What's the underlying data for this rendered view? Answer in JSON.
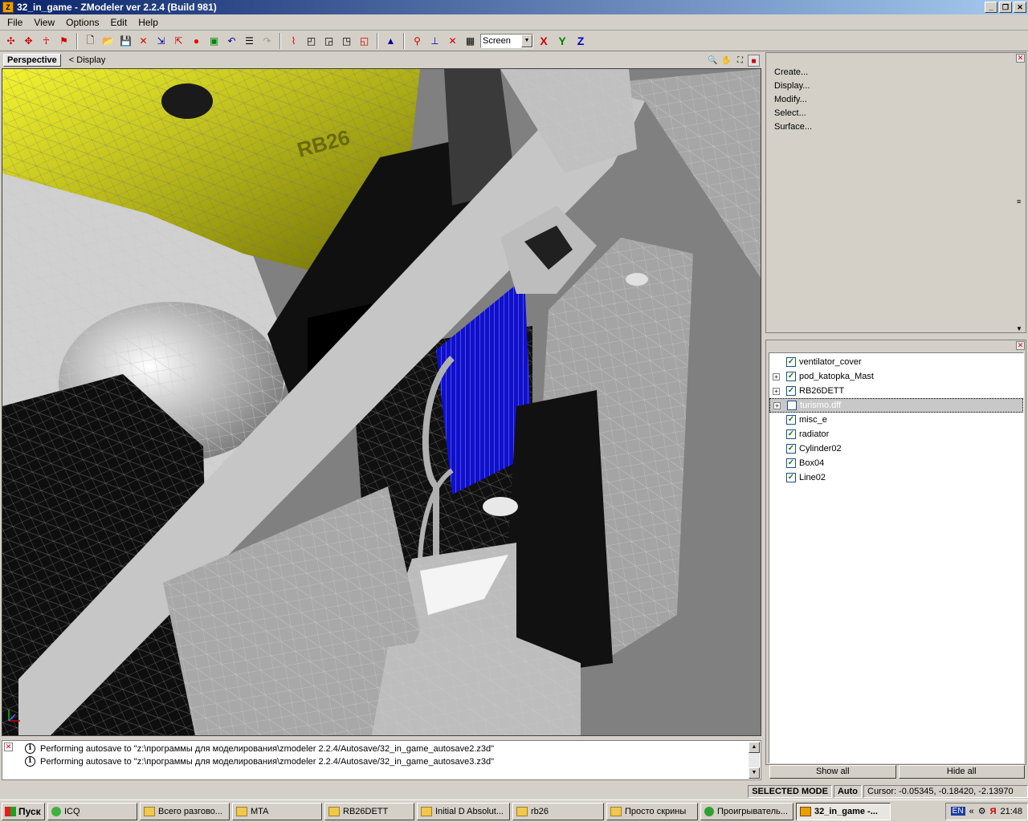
{
  "window": {
    "app_icon": "Z",
    "title": "32_in_game - ZModeler ver 2.2.4 (Build 981)"
  },
  "menu": [
    "File",
    "View",
    "Options",
    "Edit",
    "Help"
  ],
  "toolbar": {
    "view_mode": "Screen",
    "axes": [
      "X",
      "Y",
      "Z"
    ],
    "axis_colors": {
      "x": "#d00000",
      "y": "#008000",
      "z": "#0000d0"
    }
  },
  "viewport": {
    "tab": "Perspective",
    "display": "<  Display"
  },
  "commands": [
    "Create...",
    "Display...",
    "Modify...",
    "Select...",
    "Surface..."
  ],
  "hierarchy": [
    {
      "label": "ventilator_cover",
      "checked": true,
      "expandable": false
    },
    {
      "label": "pod_katopka_Mast",
      "checked": true,
      "expandable": true
    },
    {
      "label": "RB26DETT",
      "checked": true,
      "expandable": true
    },
    {
      "label": "turismo.dff",
      "checked": false,
      "expandable": true,
      "selected": true
    },
    {
      "label": "misc_e",
      "checked": true,
      "expandable": false
    },
    {
      "label": "radiator",
      "checked": true,
      "expandable": false
    },
    {
      "label": "Cylinder02",
      "checked": true,
      "expandable": false
    },
    {
      "label": "Box04",
      "checked": true,
      "expandable": false
    },
    {
      "label": "Line02",
      "checked": true,
      "expandable": false
    }
  ],
  "buttons": {
    "show_all": "Show all",
    "hide_all": "Hide all"
  },
  "log": [
    "Performing autosave to \"z:\\программы для моделирования\\zmodeler 2.2.4/Autosave/32_in_game_autosave2.z3d\"",
    "Performing autosave to \"z:\\программы для моделирования\\zmodeler 2.2.4/Autosave/32_in_game_autosave3.z3d\""
  ],
  "status": {
    "mode": "SELECTED MODE",
    "auto": "Auto",
    "cursor": "Cursor: -0.05345, -0.18420, -2.13970"
  },
  "taskbar": {
    "start": "Пуск",
    "tasks": [
      {
        "label": "ICQ",
        "icon": "icq-icon"
      },
      {
        "label": "Всего разгово...",
        "icon": "chat-icon"
      },
      {
        "label": "MTA",
        "icon": "folder-icon"
      },
      {
        "label": "RB26DETT",
        "icon": "folder-icon"
      },
      {
        "label": "Initial D Absolut...",
        "icon": "folder-icon"
      },
      {
        "label": "rb26",
        "icon": "folder-icon"
      },
      {
        "label": "Просто скрины",
        "icon": "folder-icon"
      },
      {
        "label": "Проигрыватель...",
        "icon": "player-icon"
      },
      {
        "label": "32_in_game -...",
        "icon": "zmodeler-icon",
        "active": true
      }
    ],
    "lang": "EN",
    "time": "21:48"
  }
}
